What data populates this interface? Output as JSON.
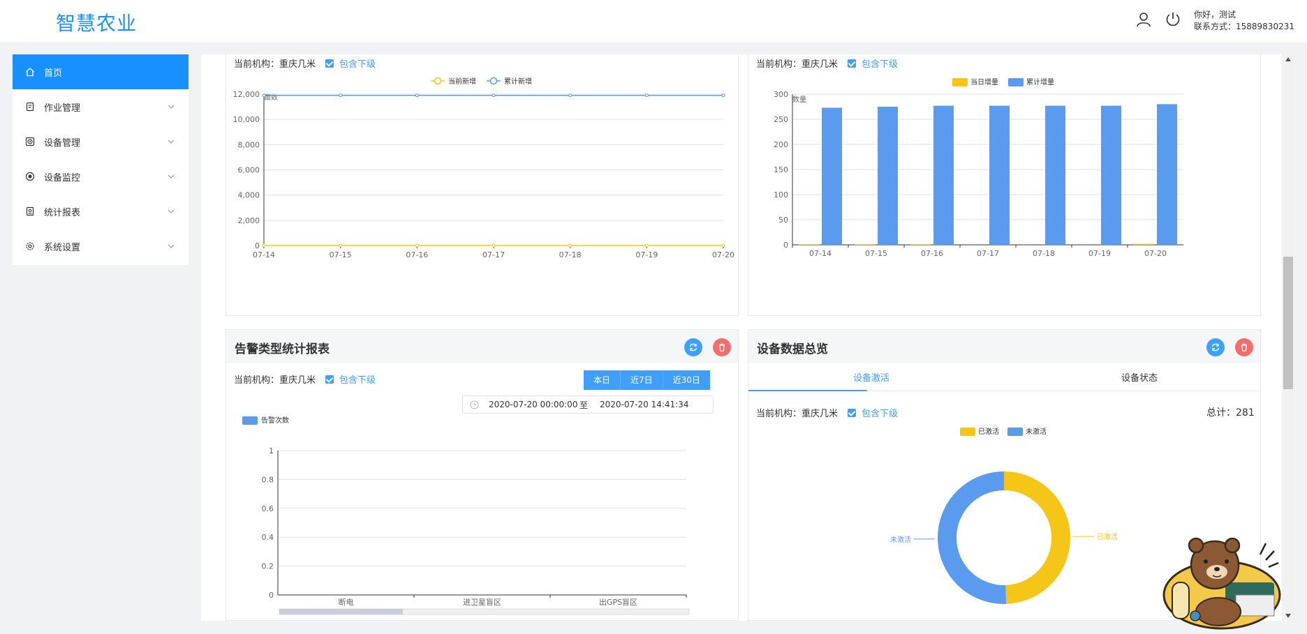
{
  "app": {
    "title": "智慧农业"
  },
  "header": {
    "greeting": "你好，测试",
    "contact": "联系方式：15889830231"
  },
  "sidebar": {
    "items": [
      {
        "label": "首页",
        "icon": "home-icon",
        "active": true
      },
      {
        "label": "作业管理",
        "icon": "document-icon"
      },
      {
        "label": "设备管理",
        "icon": "device-icon"
      },
      {
        "label": "设备监控",
        "icon": "monitor-icon"
      },
      {
        "label": "统计报表",
        "icon": "report-icon"
      },
      {
        "label": "系统设置",
        "icon": "gear-icon"
      }
    ]
  },
  "common": {
    "org_label": "当前机构：",
    "org_name": "重庆几米",
    "include_sub": "包含下级"
  },
  "panel_area": {
    "legend": [
      "当前新增",
      "累计新增"
    ],
    "ylabel": "亩数",
    "colors": {
      "current": "#f5c518",
      "cumulative": "#5b9bef"
    }
  },
  "panel_device_count": {
    "legend": [
      "当日增量",
      "累计增量"
    ],
    "ylabel": "数量",
    "colors": {
      "daily": "#f5c518",
      "cumulative": "#5b9bef"
    }
  },
  "panel_alarm": {
    "title": "告警类型统计报表",
    "buttons": [
      "本日",
      "近7日",
      "近30日"
    ],
    "range_start": "2020-07-20 00:00:00",
    "range_sep": "至",
    "range_end": "2020-07-20 14:41:34",
    "legend": "告警次数"
  },
  "panel_overview": {
    "title": "设备数据总览",
    "tabs": [
      "设备激活",
      "设备状态"
    ],
    "total": "总计：281",
    "legend": [
      "已激活",
      "未激活"
    ],
    "colors": {
      "activated": "#f5c518",
      "inactive": "#5b9bef"
    }
  },
  "chart_data": [
    {
      "type": "line",
      "x": [
        "07-14",
        "07-15",
        "07-16",
        "07-17",
        "07-18",
        "07-19",
        "07-20"
      ],
      "series": [
        {
          "name": "当前新增",
          "values": [
            0,
            0,
            0,
            0,
            0,
            0,
            0
          ]
        },
        {
          "name": "累计新增",
          "values": [
            11900,
            11900,
            11900,
            11900,
            11900,
            11900,
            11900
          ]
        }
      ],
      "ylabel": "亩数",
      "ylim": [
        0,
        12000
      ],
      "yticks": [
        "0",
        "2,000",
        "4,000",
        "6,000",
        "8,000",
        "10,000",
        "12,000"
      ],
      "grid": true,
      "legend": "top-center"
    },
    {
      "type": "bar",
      "categories": [
        "07-14",
        "07-15",
        "07-16",
        "07-17",
        "07-18",
        "07-19",
        "07-20"
      ],
      "series": [
        {
          "name": "当日增量",
          "values": [
            1,
            1,
            1,
            0,
            0,
            0,
            2
          ]
        },
        {
          "name": "累计增量",
          "values": [
            273,
            275,
            277,
            277,
            277,
            277,
            280
          ]
        }
      ],
      "ylabel": "数量",
      "ylim": [
        0,
        300
      ],
      "yticks": [
        "0",
        "50",
        "100",
        "150",
        "200",
        "250",
        "300"
      ],
      "grid": true,
      "legend": "top-center"
    },
    {
      "type": "bar",
      "categories": [
        "断电",
        "进卫星盲区",
        "出GPS盲区"
      ],
      "series": [
        {
          "name": "告警次数",
          "values": [
            0,
            0,
            0
          ]
        }
      ],
      "ylim": [
        0,
        1
      ],
      "yticks": [
        "0",
        "0.2",
        "0.4",
        "0.6",
        "0.8",
        "1"
      ],
      "grid": true,
      "legend": "top-left"
    },
    {
      "type": "pie",
      "categories": [
        "已激活",
        "未激活"
      ],
      "values": [
        139,
        142
      ],
      "legend": "top-center"
    }
  ]
}
